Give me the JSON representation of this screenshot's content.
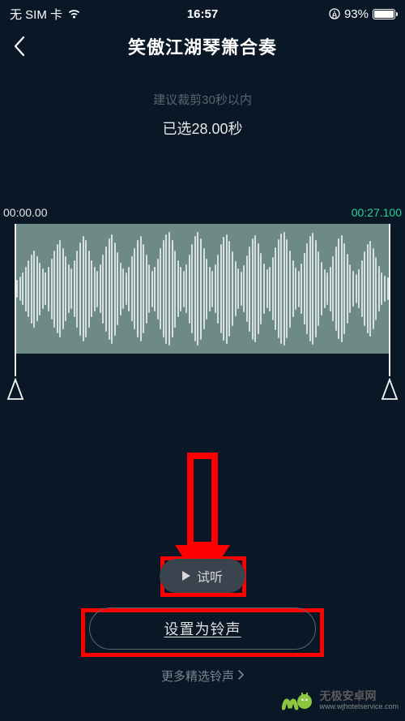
{
  "status_bar": {
    "carrier": "无 SIM 卡",
    "time": "16:57",
    "battery_pct": "93%"
  },
  "header": {
    "title": "笑傲江湖琴箫合奏"
  },
  "hint": "建议裁剪30秒以内",
  "selected": "已选28.00秒",
  "timeline": {
    "start": "00:00.00",
    "end": "00:27.100"
  },
  "buttons": {
    "preview": "试听",
    "set_ringtone": "设置为铃声",
    "more": "更多精选铃声"
  },
  "watermark": {
    "cn": "无极安卓网",
    "url": "www.wjhotelservice.com"
  }
}
